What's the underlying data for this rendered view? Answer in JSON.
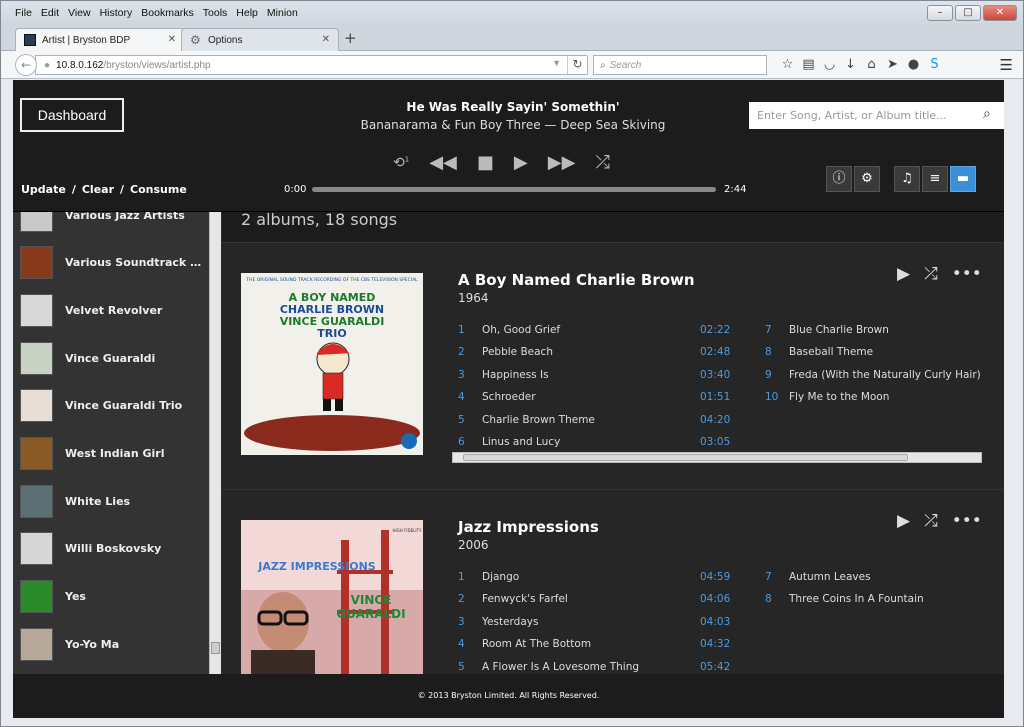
{
  "browser": {
    "menu": [
      "File",
      "Edit",
      "View",
      "History",
      "Bookmarks",
      "Tools",
      "Help",
      "Minion"
    ],
    "tabs": [
      {
        "label": "Artist | Bryston BDP"
      },
      {
        "label": "Options"
      }
    ],
    "url_host": "10.8.0.162",
    "url_path": "/bryston/views/artist.php",
    "search_placeholder": "Search"
  },
  "header": {
    "dashboard_label": "Dashboard",
    "now_playing_title": "He Was Really Sayin' Somethin'",
    "now_playing_subtitle": "Bananarama & Fun Boy Three — Deep Sea Skiving",
    "search_placeholder": "Enter Song, Artist, or Album title...",
    "time_elapsed": "0:00",
    "time_total": "2:44",
    "progress": 0,
    "queue_links": [
      "Update",
      "Clear",
      "Consume"
    ]
  },
  "sidebar": {
    "artists": [
      {
        "name": "Various Jazz Artists",
        "color": "#c9c9c9"
      },
      {
        "name": "Various Soundtrack Artists",
        "color": "#8a3a1c"
      },
      {
        "name": "Velvet Revolver",
        "color": "#d8d8d8"
      },
      {
        "name": "Vince Guaraldi",
        "color": "#c8d2c4"
      },
      {
        "name": "Vince Guaraldi Trio",
        "color": "#e6ddd6"
      },
      {
        "name": "West Indian Girl",
        "color": "#8a5a26"
      },
      {
        "name": "White Lies",
        "color": "#5c6f74"
      },
      {
        "name": "Willi Boskovsky",
        "color": "#d6d6d6"
      },
      {
        "name": "Yes",
        "color": "#2a8a2a"
      },
      {
        "name": "Yo-Yo Ma",
        "color": "#b7a99a"
      }
    ]
  },
  "main": {
    "summary": "2 albums, 18 songs",
    "albums": [
      {
        "title": "A Boy Named Charlie Brown",
        "year": "1964",
        "cover_text": [
          "THE ORIGINAL SOUND TRACK RECORDING OF THE CBS TELEVISION SPECIAL",
          "A BOY NAMED",
          "CHARLIE BROWN",
          "VINCE GUARALDI",
          "TRIO"
        ],
        "tracks": [
          {
            "n": "1",
            "t": "Oh, Good Grief",
            "d": "02:22"
          },
          {
            "n": "2",
            "t": "Pebble Beach",
            "d": "02:48"
          },
          {
            "n": "3",
            "t": "Happiness Is",
            "d": "03:40"
          },
          {
            "n": "4",
            "t": "Schroeder",
            "d": "01:51"
          },
          {
            "n": "5",
            "t": "Charlie Brown Theme",
            "d": "04:20"
          },
          {
            "n": "6",
            "t": "Linus and Lucy",
            "d": "03:05"
          },
          {
            "n": "7",
            "t": "Blue Charlie Brown",
            "d": ""
          },
          {
            "n": "8",
            "t": "Baseball Theme",
            "d": ""
          },
          {
            "n": "9",
            "t": "Freda (With the Naturally Curly Hair)",
            "d": ""
          },
          {
            "n": "10",
            "t": "Fly Me to the Moon",
            "d": ""
          }
        ]
      },
      {
        "title": "Jazz Impressions",
        "year": "2006",
        "cover_text": [
          "JAZZ IMPRESSIONS",
          "VINCE",
          "GUARALDI",
          "HIGH FIDELITY"
        ],
        "tracks": [
          {
            "n": "1",
            "t": "Django",
            "d": "04:59"
          },
          {
            "n": "2",
            "t": "Fenwyck's Farfel",
            "d": "04:06"
          },
          {
            "n": "3",
            "t": "Yesterdays",
            "d": "04:03"
          },
          {
            "n": "4",
            "t": "Room At The Bottom",
            "d": "04:32"
          },
          {
            "n": "5",
            "t": "A Flower Is A Lovesome Thing",
            "d": "05:42"
          },
          {
            "n": "7",
            "t": "Autumn Leaves",
            "d": ""
          },
          {
            "n": "8",
            "t": "Three Coins In A Fountain",
            "d": ""
          }
        ]
      }
    ]
  },
  "footer": {
    "text": "© 2013 Bryston Limited. All Rights Reserved."
  },
  "colors": {
    "accent": "#3a8fd6",
    "track_number": "#4c9be0"
  }
}
